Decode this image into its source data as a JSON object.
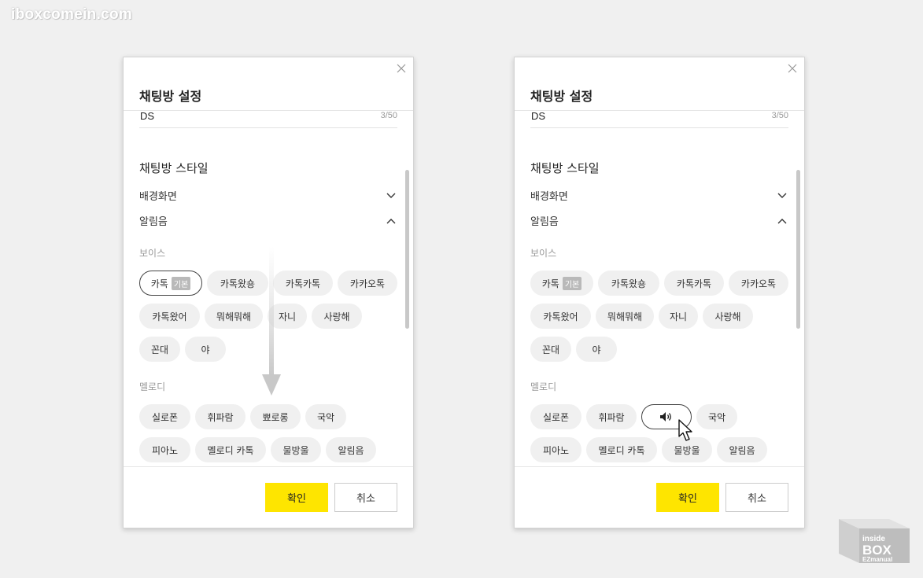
{
  "watermark": "iboxcomein.com",
  "dialog": {
    "title": "채팅방 설정",
    "name_value": "DS",
    "name_count": "3/50",
    "style_title": "채팅방 스타일",
    "background_label": "배경화면",
    "alert_label": "알림음",
    "voice_label": "보이스",
    "melody_label": "멜로디",
    "default_badge": "기본",
    "voice_rows": [
      [
        "카톡",
        "카톡왔숑",
        "카톡카톡",
        "카카오톡"
      ],
      [
        "카톡왔어",
        "뭐해뭐해",
        "자니",
        "사랑해"
      ],
      [
        "꼰대",
        "야"
      ]
    ],
    "melody_rows": [
      [
        "실로폰",
        "휘파람",
        "뾰로롱",
        "국악"
      ],
      [
        "피아노",
        "멜로디 카톡",
        "물방울",
        "알림음"
      ]
    ],
    "ok_label": "확인",
    "cancel_label": "취소"
  },
  "logo": {
    "line1": "inside",
    "line2": "BOX",
    "line3": "EZmanual"
  },
  "colors": {
    "ok_button": "#fee500",
    "selected_chip_border": "#444444"
  },
  "icons": {
    "speaker": "speaker-icon",
    "close": "close-icon",
    "cursor": "cursor-icon"
  }
}
